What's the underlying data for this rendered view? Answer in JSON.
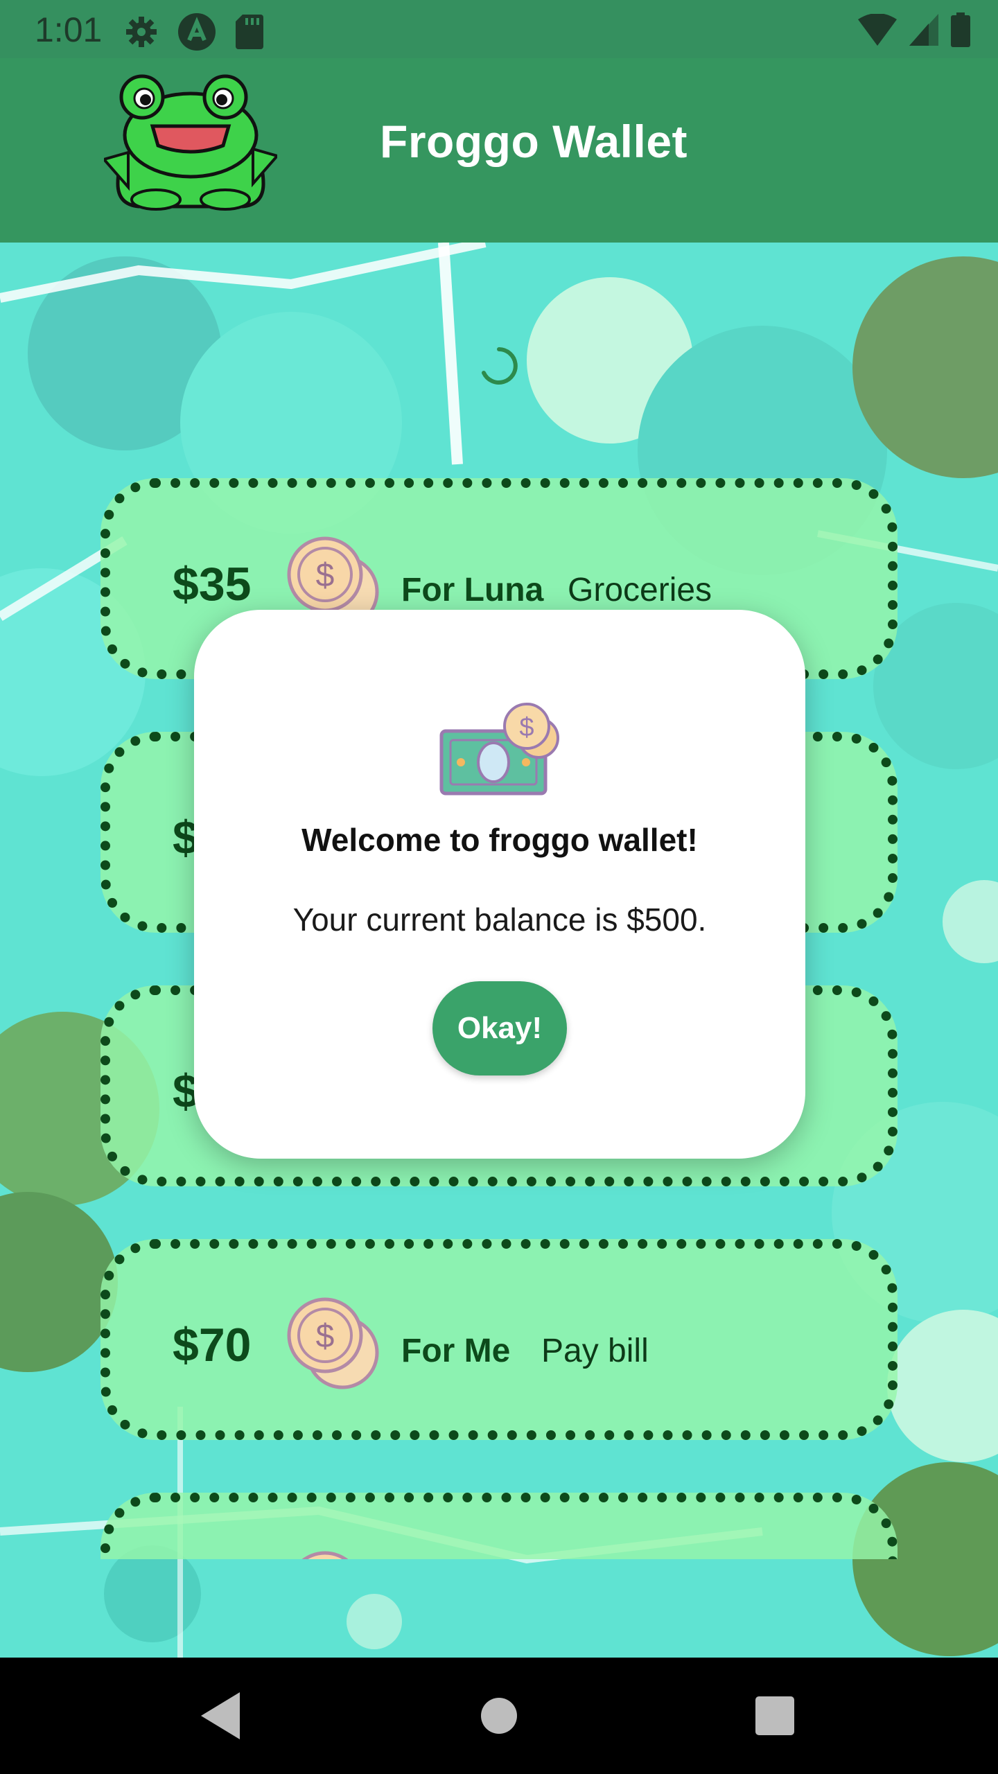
{
  "status_bar": {
    "time": "1:01",
    "icons_left": [
      "settings-icon",
      "accessibility-icon",
      "sd-card-icon"
    ],
    "icons_right": [
      "wifi-icon",
      "cell-signal-icon",
      "battery-icon"
    ]
  },
  "app_bar": {
    "title": "Froggo Wallet",
    "logo": "frog-logo"
  },
  "transactions": [
    {
      "amount": "$35",
      "recipient": "For Luna",
      "description": "Groceries"
    },
    {
      "amount": "$",
      "recipient": "",
      "description": ""
    },
    {
      "amount": "$",
      "recipient": "",
      "description": ""
    },
    {
      "amount": "$70",
      "recipient": "For Me",
      "description": "Pay bill"
    },
    {
      "amount": "",
      "recipient": "",
      "description": ""
    }
  ],
  "dialog": {
    "icon": "money-icon",
    "title": "Welcome to froggo wallet!",
    "message": "Your current balance is $500.",
    "button_label": "Okay!"
  },
  "nav_bar": {
    "buttons": [
      "back-icon",
      "home-icon",
      "recents-icon"
    ]
  },
  "colors": {
    "app_bar": "#35965f",
    "card_border": "#0d4a1b",
    "card_fill": "#96f5aa",
    "button": "#3aa36a"
  }
}
